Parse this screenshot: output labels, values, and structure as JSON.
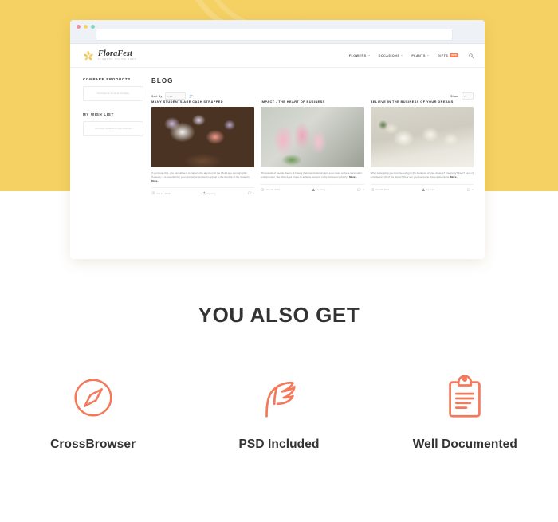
{
  "theme": {
    "band_color": "#f5d163",
    "accent_color": "#f87b52",
    "heading_color": "#333333"
  },
  "browser": {
    "url_value": "",
    "url_placeholder": "",
    "dots": [
      "close-dot",
      "minimize-dot",
      "maximize-dot"
    ]
  },
  "site": {
    "logo_name": "FloraFest",
    "logo_tagline": "FLOWERS ONLINE SHOP",
    "nav": [
      {
        "label": "FLOWERS",
        "caret": true,
        "badge": ""
      },
      {
        "label": "OCCASIONS",
        "caret": true,
        "badge": ""
      },
      {
        "label": "PLANTS",
        "caret": true,
        "badge": ""
      },
      {
        "label": "GIFTS",
        "caret": false,
        "badge": "NEW"
      }
    ],
    "search_label": "Search"
  },
  "sidebar": {
    "blocks": [
      {
        "title": "COMPARE PRODUCTS",
        "empty_text": "You have no items to compare."
      },
      {
        "title": "MY WISH LIST",
        "empty_text": "You have no items in your wish list."
      }
    ]
  },
  "content": {
    "page_title": "BLOG",
    "sort_label": "Sort By",
    "sort_value": "Date",
    "sort_direction": "ascending",
    "show_label": "Show",
    "show_value": "9"
  },
  "posts": [
    {
      "title": "MANY STUDENTS ARE CASH STRAPPED",
      "thumb_class": "thumb-1",
      "thumb_alt": "bouquet-of-pink-and-white-flowers",
      "excerpt": "If you know this, you can utilise it to capture the attention of the 18-24 age demographic. However, it is essential for your product or service to appeal to the lifestyle of the students.",
      "more_label": "More...",
      "date": "Oct 11, 2016",
      "author": "by Greg",
      "comments": "0"
    },
    {
      "title": "IMPACT - THE HEART OF BUSINESS",
      "thumb_class": "thumb-2",
      "thumb_alt": "pink-tulips-in-a-bowl",
      "excerpt": "Thousands of people dream of having their own business and even more so be a successful entrepreneur. But what does it take to achieve success in the business industry?",
      "more_label": "More...",
      "date": "Oct 10, 2016",
      "author": "by Greg",
      "comments": "0"
    },
    {
      "title": "BELIEVE IN THE BUSINESS OF YOUR DREAMS",
      "thumb_class": "thumb-3",
      "thumb_alt": "white-roses-bouquet",
      "excerpt": "What is stopping you from believing in the business of your dreams? Insecurity? Fear? Lack of confidence? All of the above? How can you overcome these distractions.",
      "more_label": "More...",
      "date": "Oct 05, 2016",
      "author": "by Kate",
      "comments": "2"
    }
  ],
  "also_get": {
    "title": "YOU ALSO GET",
    "features": [
      {
        "label": "CrossBrowser",
        "icon": "compass-icon"
      },
      {
        "label": "PSD Included",
        "icon": "feather-icon"
      },
      {
        "label": "Well Documented",
        "icon": "clipboard-icon"
      }
    ]
  }
}
